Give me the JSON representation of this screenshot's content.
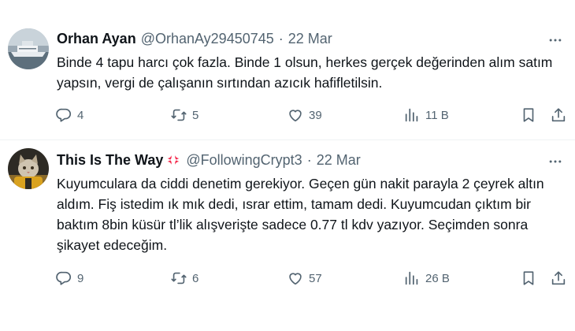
{
  "tweets": [
    {
      "name": "Orhan Ayan",
      "handle": "@OrhanAy29450745",
      "separator": "·",
      "date": "22 Mar",
      "text": "Binde 4 tapu harcı çok fazla. Binde 1 olsun, herkes gerçek değerinden alım satım yapsın, vergi de çalışanın sırtından azıcık hafifletilsin.",
      "replies": "4",
      "retweets": "5",
      "likes": "39",
      "views": "11 B"
    },
    {
      "name": "This Is The Way",
      "name_emoji": "anger-symbol-icon",
      "handle": "@FollowingCrypt3",
      "separator": "·",
      "date": "22 Mar",
      "text": "Kuyumculara da ciddi denetim gerekiyor. Geçen gün nakit parayla 2 çeyrek altın aldım. Fiş istedim ık mık dedi, ısrar ettim, tamam dedi. Kuyumcudan çıktım bir baktım 8bin küsür tl’lik alışverişte sadece 0.77 tl kdv yazıyor. Seçimden sonra şikayet edeceğim.",
      "replies": "9",
      "retweets": "6",
      "likes": "57",
      "views": "26 B"
    }
  ],
  "icons": [
    "more-icon",
    "reply-icon",
    "retweet-icon",
    "like-icon",
    "views-icon",
    "bookmark-icon",
    "share-icon"
  ],
  "colors": {
    "text": "#0f1419",
    "secondary": "#536471",
    "divider": "#eff3f4",
    "anger": "#f4274a"
  }
}
